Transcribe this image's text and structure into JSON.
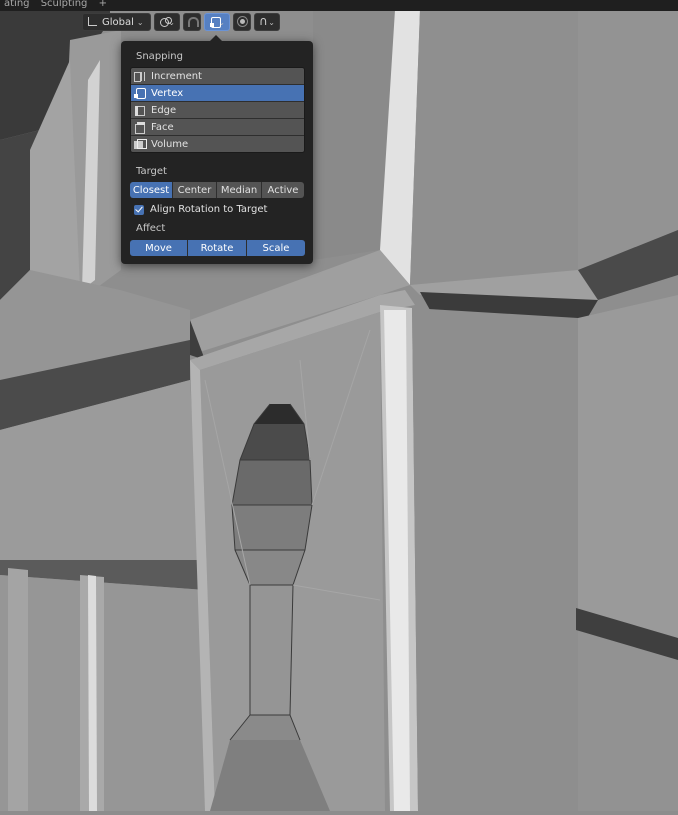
{
  "topbar": {
    "tabs": [
      "ating",
      "Sculpting",
      "+"
    ]
  },
  "header": {
    "orientation_label": "Global",
    "icons": [
      "transform-orientation-icon",
      "pivot-point-icon",
      "snap-magnet-icon",
      "snap-vertex-icon",
      "proportional-edit-icon",
      "falloff-curve-icon"
    ],
    "chevron": "⌄"
  },
  "popover": {
    "snapping_title": "Snapping",
    "snap_elements": [
      {
        "label": "Increment",
        "icon": "increment-icon",
        "selected": false
      },
      {
        "label": "Vertex",
        "icon": "vertex-icon",
        "selected": true
      },
      {
        "label": "Edge",
        "icon": "edge-icon",
        "selected": false
      },
      {
        "label": "Face",
        "icon": "face-icon",
        "selected": false
      },
      {
        "label": "Volume",
        "icon": "volume-icon",
        "selected": false
      }
    ],
    "target_title": "Target",
    "target_options": [
      "Closest",
      "Center",
      "Median",
      "Active"
    ],
    "target_selected": "Closest",
    "align_rotation_label": "Align Rotation to Target",
    "align_rotation_checked": true,
    "affect_title": "Affect",
    "affect_options": [
      "Move",
      "Rotate",
      "Scale"
    ],
    "affect_selected": [
      "Move",
      "Rotate",
      "Scale"
    ]
  },
  "colors": {
    "accent": "#4772b3",
    "panel_bg": "#232323",
    "item_bg": "#545454",
    "viewport_bg": "#8d8d8d"
  }
}
